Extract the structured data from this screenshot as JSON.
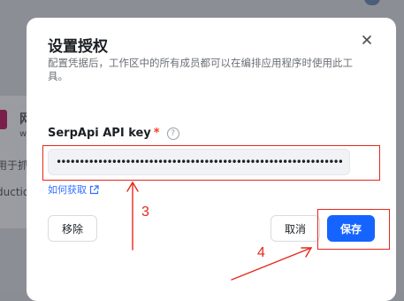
{
  "background": {
    "app_name_fragment": "网",
    "line1_fragment": "w",
    "line2_fragment": "用于抓",
    "line3_fragment": "ductio"
  },
  "dialog": {
    "title": "设置授权",
    "description": "配置凭据后，工作区中的所有成员都可以在编排应用程序时使用此工具。",
    "field_label": "SerpApi API key",
    "required_mark": "*",
    "help_icon_glyph": "?",
    "api_key_value": "••••••••••••••••••••••••••••••••••••••••••••••••••••••••••••••••",
    "help_link": "如何获取",
    "remove_button": "移除",
    "cancel_button": "取消",
    "save_button": "保存"
  },
  "annotations": {
    "label_3": "3",
    "label_4": "4",
    "color": "#e5281a"
  },
  "colors": {
    "primary": "#1664ff",
    "link": "#3370ff",
    "required": "#f93920"
  }
}
